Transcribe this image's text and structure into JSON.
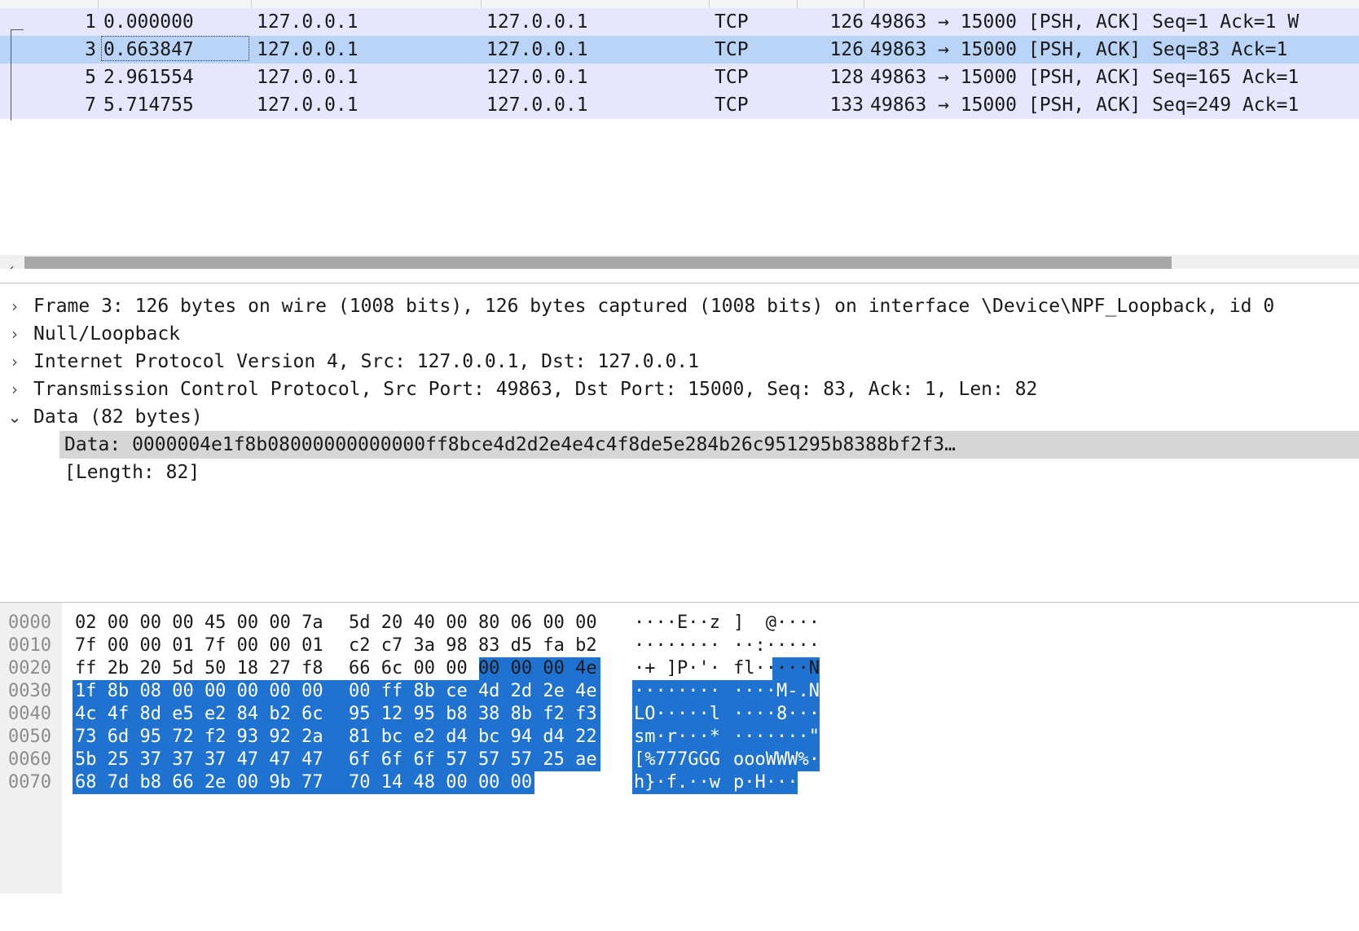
{
  "packet_list": {
    "rows": [
      {
        "no": "1",
        "time": "0.000000",
        "src": "127.0.0.1",
        "dst": "127.0.0.1",
        "proto": "TCP",
        "len": "126",
        "info": "49863 → 15000 [PSH, ACK] Seq=1 Ack=1 W"
      },
      {
        "no": "3",
        "time": "0.663847",
        "src": "127.0.0.1",
        "dst": "127.0.0.1",
        "proto": "TCP",
        "len": "126",
        "info": "49863 → 15000 [PSH, ACK] Seq=83 Ack=1"
      },
      {
        "no": "5",
        "time": "2.961554",
        "src": "127.0.0.1",
        "dst": "127.0.0.1",
        "proto": "TCP",
        "len": "128",
        "info": "49863 → 15000 [PSH, ACK] Seq=165 Ack=1"
      },
      {
        "no": "7",
        "time": "5.714755",
        "src": "127.0.0.1",
        "dst": "127.0.0.1",
        "proto": "TCP",
        "len": "133",
        "info": "49863 → 15000 [PSH, ACK] Seq=249 Ack=1"
      }
    ],
    "selected_row": 1,
    "scroll_left_arrow": "‹"
  },
  "details": {
    "items": [
      {
        "chevron": "›",
        "text": "Frame 3: 126 bytes on wire (1008 bits), 126 bytes captured (1008 bits) on interface \\Device\\NPF_Loopback, id 0"
      },
      {
        "chevron": "›",
        "text": "Null/Loopback"
      },
      {
        "chevron": "›",
        "text": "Internet Protocol Version 4, Src: 127.0.0.1, Dst: 127.0.0.1"
      },
      {
        "chevron": "›",
        "text": "Transmission Control Protocol, Src Port: 49863, Dst Port: 15000, Seq: 83, Ack: 1, Len: 82"
      },
      {
        "chevron": "⌄",
        "text": "Data (82 bytes)"
      }
    ],
    "children": [
      {
        "text": "Data: 0000004e1f8b08000000000000ff8bce4d2d2e4e4c4f8de5e284b26c951295b8388bf2f3…"
      },
      {
        "text": "[Length: 82]"
      }
    ]
  },
  "bytes": {
    "lines": [
      {
        "offset": "0000",
        "hexA": "02 00 00 00 45 00 00 7a",
        "hexB": "5d 20 40 00 80 06 00 00",
        "ascA": "····E··z",
        "ascB": "]  @····"
      },
      {
        "offset": "0010",
        "hexA": "7f 00 00 01 7f 00 00 01",
        "hexB": "c2 c7 3a 98 83 d5 fa b2",
        "ascA": "········",
        "ascB": "··:·····"
      },
      {
        "offset": "0020",
        "hexA": "ff 2b 20 5d 50 18 27 f8",
        "hexB": "66 6c 00 00 00 00 00 4e",
        "ascA": "·+ ]P·'·",
        "ascB": "fl·····N"
      },
      {
        "offset": "0030",
        "hexA": "1f 8b 08 00 00 00 00 00",
        "hexB": "00 ff 8b ce 4d 2d 2e 4e",
        "ascA": "········",
        "ascB": "····M-.N"
      },
      {
        "offset": "0040",
        "hexA": "4c 4f 8d e5 e2 84 b2 6c",
        "hexB": "95 12 95 b8 38 8b f2 f3",
        "ascA": "LO·····l",
        "ascB": "····8···"
      },
      {
        "offset": "0050",
        "hexA": "73 6d 95 72 f2 93 92 2a",
        "hexB": "81 bc e2 d4 bc 94 d4 22",
        "ascA": "sm·r···*",
        "ascB": "·······\""
      },
      {
        "offset": "0060",
        "hexA": "5b 25 37 37 37 47 47 47",
        "hexB": "6f 6f 6f 57 57 57 25 ae",
        "ascA": "[%777GGG",
        "ascB": "oooWWW%·"
      },
      {
        "offset": "0070",
        "hexA": "68 7d b8 66 2e 00 9b 77",
        "hexB": "70 14 48 00 00 00",
        "ascA": "h}·f.··w",
        "ascB": "p·H···"
      }
    ],
    "selection_color": "#1f72d0"
  }
}
